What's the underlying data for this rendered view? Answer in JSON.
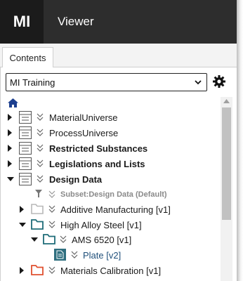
{
  "header": {
    "logo": "MI",
    "title": "Viewer"
  },
  "tabs": [
    {
      "label": "Contents"
    }
  ],
  "database_select": {
    "value": "MI Training"
  },
  "tree": {
    "items": [
      {
        "label": "MaterialUniverse"
      },
      {
        "label": "ProcessUniverse"
      },
      {
        "label": "Restricted Substances"
      },
      {
        "label": "Legislations and Lists"
      },
      {
        "label": "Design Data"
      },
      {
        "label": "Subset:Design Data (Default)"
      },
      {
        "label": "Additive Manufacturing [v1]"
      },
      {
        "label": "High Alloy Steel [v1]"
      },
      {
        "label": "AMS 6520 [v1]"
      },
      {
        "label": "Plate [v2]"
      },
      {
        "label": "Materials Calibration [v1]"
      }
    ]
  },
  "colors": {
    "topbar": "#2d2d2d",
    "accent_teal": "#1e6c78",
    "link": "#1f4f7a",
    "partial_red": "#e05030"
  }
}
